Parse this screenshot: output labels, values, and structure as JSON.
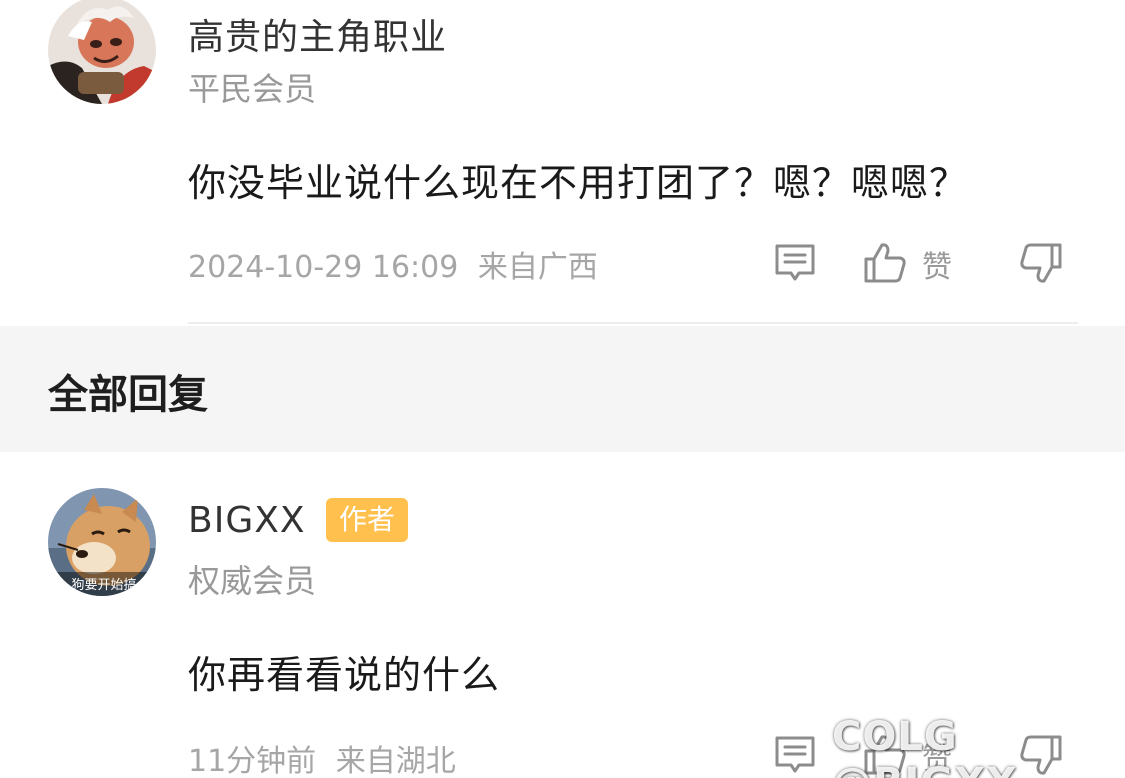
{
  "top_comment": {
    "username": "高贵的主角职业",
    "member_level": "平民会员",
    "text": "你没毕业说什么现在不用打团了？嗯？嗯嗯？",
    "timestamp": "2024-10-29 16:09",
    "location": "来自广西",
    "like_label": "赞",
    "icons": [
      "comment-icon",
      "thumbs-up-icon",
      "thumbs-down-icon"
    ]
  },
  "section": {
    "title": "全部回复"
  },
  "reply": {
    "username": "BIGXX",
    "badge": "作者",
    "member_level": "权威会员",
    "text": "你再看看说的什么",
    "time_ago": "11分钟前",
    "location": "来自湖北",
    "like_label": "赞",
    "avatar_caption": "狗要开始搞",
    "icons": [
      "comment-icon",
      "thumbs-up-icon",
      "thumbs-down-icon"
    ]
  },
  "watermark": "COLG @BIGXX",
  "colors": {
    "badge": "#ffc04d",
    "section_bg": "#f5f5f5",
    "meta_text": "#a6a6a6"
  }
}
